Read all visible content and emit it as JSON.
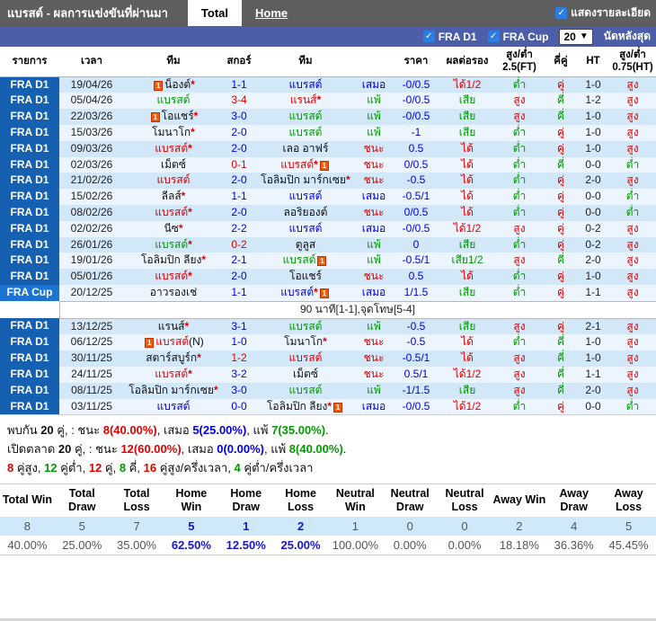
{
  "header": {
    "title": "แบรสต์ - ผลการแข่งขันที่ผ่านมา",
    "tabs": [
      {
        "label": "Total",
        "active": true
      },
      {
        "label": "Home",
        "active": false
      }
    ],
    "show_details_label": "แสดงรายละเอียด"
  },
  "filter_bar": {
    "leagues": [
      "FRA D1",
      "FRA Cup"
    ],
    "match_count": "20",
    "last_matches_label": "นัดหลังสุด"
  },
  "colors": {
    "topbar_bg": "#5e5e5e",
    "filterbar_bg": "#4c5ea8",
    "checkbox_blue": "#2b7de0",
    "fra_d1_bg": "#1560b0",
    "fra_cup_bg": "#1a74d4",
    "row_odd_bg": "#d2e7f7",
    "row_even_bg": "#ecf5fd",
    "win_red": "#e00000",
    "draw_blue": "#0000e0",
    "loss_green": "#009900",
    "text_black": "#111111",
    "stats_count_bg": "#cfe9fb",
    "home_stat_blue": "#1515cc",
    "muted_gray": "#555555",
    "card_icon_orange": "#f25c05"
  },
  "table": {
    "headers": [
      "รายการ",
      "เวลา",
      "ทีม",
      "สกอร์",
      "ทีม",
      "",
      "ราคา",
      "ผลต่อรอง",
      "สูง/ต่ำ 2.5(FT)",
      "คี่คู่",
      "HT",
      "สูง/ต่ำ 0.75(HT)"
    ]
  },
  "matches": [
    {
      "league": "FRA D1",
      "date": "19/04/26",
      "home": {
        "name": "น็องต์",
        "color": "black",
        "star": true,
        "icon": "before"
      },
      "score": {
        "t": "1-1",
        "c": "blue"
      },
      "away": {
        "name": "แบรสต์",
        "color": "blue",
        "star": false,
        "icon": null
      },
      "result": {
        "t": "เสมอ",
        "c": "blue"
      },
      "handicap": "-0/0.5",
      "hdp_result": {
        "t": "ได้1/2",
        "c": "red"
      },
      "ou25": {
        "t": "ต่ำ",
        "c": "green"
      },
      "odd_even": {
        "t": "คู่",
        "c": "red"
      },
      "ht": "1-0",
      "ou075": {
        "t": "สูง",
        "c": "red"
      }
    },
    {
      "league": "FRA D1",
      "date": "05/04/26",
      "home": {
        "name": "แบรสต์",
        "color": "green",
        "star": false,
        "icon": null
      },
      "score": {
        "t": "3-4",
        "c": "red"
      },
      "away": {
        "name": "แรนส์",
        "color": "red",
        "star": true,
        "icon": null
      },
      "result": {
        "t": "แพ้",
        "c": "green"
      },
      "handicap": "-0/0.5",
      "hdp_result": {
        "t": "เสีย",
        "c": "green"
      },
      "ou25": {
        "t": "สูง",
        "c": "red"
      },
      "odd_even": {
        "t": "คี่",
        "c": "green"
      },
      "ht": "1-2",
      "ou075": {
        "t": "สูง",
        "c": "red"
      }
    },
    {
      "league": "FRA D1",
      "date": "22/03/26",
      "home": {
        "name": "โอแชร์",
        "color": "black",
        "star": true,
        "icon": "before"
      },
      "score": {
        "t": "3-0",
        "c": "blue"
      },
      "away": {
        "name": "แบรสต์",
        "color": "green",
        "star": false,
        "icon": null
      },
      "result": {
        "t": "แพ้",
        "c": "green"
      },
      "handicap": "-0/0.5",
      "hdp_result": {
        "t": "เสีย",
        "c": "green"
      },
      "ou25": {
        "t": "สูง",
        "c": "red"
      },
      "odd_even": {
        "t": "คี่",
        "c": "green"
      },
      "ht": "1-0",
      "ou075": {
        "t": "สูง",
        "c": "red"
      }
    },
    {
      "league": "FRA D1",
      "date": "15/03/26",
      "home": {
        "name": "โมนาโก",
        "color": "black",
        "star": true,
        "icon": null
      },
      "score": {
        "t": "2-0",
        "c": "blue"
      },
      "away": {
        "name": "แบรสต์",
        "color": "green",
        "star": false,
        "icon": null
      },
      "result": {
        "t": "แพ้",
        "c": "green"
      },
      "handicap": "-1",
      "hdp_result": {
        "t": "เสีย",
        "c": "green"
      },
      "ou25": {
        "t": "ต่ำ",
        "c": "green"
      },
      "odd_even": {
        "t": "คู่",
        "c": "red"
      },
      "ht": "1-0",
      "ou075": {
        "t": "สูง",
        "c": "red"
      }
    },
    {
      "league": "FRA D1",
      "date": "09/03/26",
      "home": {
        "name": "แบรสต์",
        "color": "red",
        "star": true,
        "icon": null
      },
      "score": {
        "t": "2-0",
        "c": "blue"
      },
      "away": {
        "name": "เลอ อาฟร์",
        "color": "black",
        "star": false,
        "icon": null
      },
      "result": {
        "t": "ชนะ",
        "c": "red"
      },
      "handicap": "0.5",
      "hdp_result": {
        "t": "ได้",
        "c": "red"
      },
      "ou25": {
        "t": "ต่ำ",
        "c": "green"
      },
      "odd_even": {
        "t": "คู่",
        "c": "red"
      },
      "ht": "1-0",
      "ou075": {
        "t": "สูง",
        "c": "red"
      }
    },
    {
      "league": "FRA D1",
      "date": "02/03/26",
      "home": {
        "name": "เม็ตซ์",
        "color": "black",
        "star": false,
        "icon": null
      },
      "score": {
        "t": "0-1",
        "c": "red"
      },
      "away": {
        "name": "แบรสต์",
        "color": "red",
        "star": true,
        "icon": "after"
      },
      "result": {
        "t": "ชนะ",
        "c": "red"
      },
      "handicap": "0/0.5",
      "hdp_result": {
        "t": "ได้",
        "c": "red"
      },
      "ou25": {
        "t": "ต่ำ",
        "c": "green"
      },
      "odd_even": {
        "t": "คี่",
        "c": "green"
      },
      "ht": "0-0",
      "ou075": {
        "t": "ต่ำ",
        "c": "green"
      }
    },
    {
      "league": "FRA D1",
      "date": "21/02/26",
      "home": {
        "name": "แบรสต์",
        "color": "red",
        "star": false,
        "icon": null
      },
      "score": {
        "t": "2-0",
        "c": "blue"
      },
      "away": {
        "name": "โอลิมปิก มาร์กเซย",
        "color": "black",
        "star": true,
        "icon": null
      },
      "result": {
        "t": "ชนะ",
        "c": "red"
      },
      "handicap": "-0.5",
      "hdp_result": {
        "t": "ได้",
        "c": "red"
      },
      "ou25": {
        "t": "ต่ำ",
        "c": "green"
      },
      "odd_even": {
        "t": "คู่",
        "c": "red"
      },
      "ht": "2-0",
      "ou075": {
        "t": "สูง",
        "c": "red"
      }
    },
    {
      "league": "FRA D1",
      "date": "15/02/26",
      "home": {
        "name": "ลีลส์",
        "color": "black",
        "star": true,
        "icon": null
      },
      "score": {
        "t": "1-1",
        "c": "blue"
      },
      "away": {
        "name": "แบรสต์",
        "color": "blue",
        "star": false,
        "icon": null
      },
      "result": {
        "t": "เสมอ",
        "c": "blue"
      },
      "handicap": "-0.5/1",
      "hdp_result": {
        "t": "ได้",
        "c": "red"
      },
      "ou25": {
        "t": "ต่ำ",
        "c": "green"
      },
      "odd_even": {
        "t": "คู่",
        "c": "red"
      },
      "ht": "0-0",
      "ou075": {
        "t": "ต่ำ",
        "c": "green"
      }
    },
    {
      "league": "FRA D1",
      "date": "08/02/26",
      "home": {
        "name": "แบรสต์",
        "color": "red",
        "star": true,
        "icon": null
      },
      "score": {
        "t": "2-0",
        "c": "blue"
      },
      "away": {
        "name": "ลอริยองต์",
        "color": "black",
        "star": false,
        "icon": null
      },
      "result": {
        "t": "ชนะ",
        "c": "red"
      },
      "handicap": "0/0.5",
      "hdp_result": {
        "t": "ได้",
        "c": "red"
      },
      "ou25": {
        "t": "ต่ำ",
        "c": "green"
      },
      "odd_even": {
        "t": "คู่",
        "c": "red"
      },
      "ht": "0-0",
      "ou075": {
        "t": "ต่ำ",
        "c": "green"
      }
    },
    {
      "league": "FRA D1",
      "date": "02/02/26",
      "home": {
        "name": "นีซ",
        "color": "black",
        "star": true,
        "icon": null
      },
      "score": {
        "t": "2-2",
        "c": "blue"
      },
      "away": {
        "name": "แบรสต์",
        "color": "blue",
        "star": false,
        "icon": null
      },
      "result": {
        "t": "เสมอ",
        "c": "blue"
      },
      "handicap": "-0/0.5",
      "hdp_result": {
        "t": "ได้1/2",
        "c": "red"
      },
      "ou25": {
        "t": "สูง",
        "c": "red"
      },
      "odd_even": {
        "t": "คู่",
        "c": "red"
      },
      "ht": "0-2",
      "ou075": {
        "t": "สูง",
        "c": "red"
      }
    },
    {
      "league": "FRA D1",
      "date": "26/01/26",
      "home": {
        "name": "แบรสต์",
        "color": "green",
        "star": true,
        "icon": null
      },
      "score": {
        "t": "0-2",
        "c": "red"
      },
      "away": {
        "name": "ตูลูส",
        "color": "black",
        "star": false,
        "icon": null
      },
      "result": {
        "t": "แพ้",
        "c": "green"
      },
      "handicap": "0",
      "hdp_result": {
        "t": "เสีย",
        "c": "green"
      },
      "ou25": {
        "t": "ต่ำ",
        "c": "green"
      },
      "odd_even": {
        "t": "คู่",
        "c": "red"
      },
      "ht": "0-2",
      "ou075": {
        "t": "สูง",
        "c": "red"
      }
    },
    {
      "league": "FRA D1",
      "date": "19/01/26",
      "home": {
        "name": "โอลิมปิก ลียง",
        "color": "black",
        "star": true,
        "icon": null
      },
      "score": {
        "t": "2-1",
        "c": "blue"
      },
      "away": {
        "name": "แบรสต์",
        "color": "green",
        "star": false,
        "icon": "after"
      },
      "result": {
        "t": "แพ้",
        "c": "green"
      },
      "handicap": "-0.5/1",
      "hdp_result": {
        "t": "เสีย1/2",
        "c": "green"
      },
      "ou25": {
        "t": "สูง",
        "c": "red"
      },
      "odd_even": {
        "t": "คี่",
        "c": "green"
      },
      "ht": "2-0",
      "ou075": {
        "t": "สูง",
        "c": "red"
      }
    },
    {
      "league": "FRA D1",
      "date": "05/01/26",
      "home": {
        "name": "แบรสต์",
        "color": "red",
        "star": true,
        "icon": null
      },
      "score": {
        "t": "2-0",
        "c": "blue"
      },
      "away": {
        "name": "โอแชร์",
        "color": "black",
        "star": false,
        "icon": null
      },
      "result": {
        "t": "ชนะ",
        "c": "red"
      },
      "handicap": "0.5",
      "hdp_result": {
        "t": "ได้",
        "c": "red"
      },
      "ou25": {
        "t": "ต่ำ",
        "c": "green"
      },
      "odd_even": {
        "t": "คู่",
        "c": "red"
      },
      "ht": "1-0",
      "ou075": {
        "t": "สูง",
        "c": "red"
      }
    },
    {
      "league": "FRA Cup",
      "date": "20/12/25",
      "home": {
        "name": "อาวรองเช่",
        "color": "black",
        "star": false,
        "icon": null
      },
      "score": {
        "t": "1-1",
        "c": "blue"
      },
      "away": {
        "name": "แบรสต์",
        "color": "blue",
        "star": true,
        "icon": "after"
      },
      "result": {
        "t": "เสมอ",
        "c": "blue"
      },
      "handicap": "1/1.5",
      "hdp_result": {
        "t": "เสีย",
        "c": "green"
      },
      "ou25": {
        "t": "ต่ำ",
        "c": "green"
      },
      "odd_even": {
        "t": "คู่",
        "c": "red"
      },
      "ht": "1-1",
      "ou075": {
        "t": "สูง",
        "c": "red"
      }
    },
    {
      "note": "90 นาที[1-1],จุดโทษ[5-4]"
    },
    {
      "league": "FRA D1",
      "date": "13/12/25",
      "home": {
        "name": "แรนส์",
        "color": "black",
        "star": true,
        "icon": null
      },
      "score": {
        "t": "3-1",
        "c": "blue"
      },
      "away": {
        "name": "แบรสต์",
        "color": "green",
        "star": false,
        "icon": null
      },
      "result": {
        "t": "แพ้",
        "c": "green"
      },
      "handicap": "-0.5",
      "hdp_result": {
        "t": "เสีย",
        "c": "green"
      },
      "ou25": {
        "t": "สูง",
        "c": "red"
      },
      "odd_even": {
        "t": "คู่",
        "c": "red"
      },
      "ht": "2-1",
      "ou075": {
        "t": "สูง",
        "c": "red"
      }
    },
    {
      "league": "FRA D1",
      "date": "06/12/25",
      "home": {
        "name": "แบรสต์",
        "color": "red",
        "star": false,
        "icon": "before",
        "suffix": "(N)"
      },
      "score": {
        "t": "1-0",
        "c": "blue"
      },
      "away": {
        "name": "โมนาโก",
        "color": "black",
        "star": true,
        "icon": null
      },
      "result": {
        "t": "ชนะ",
        "c": "red"
      },
      "handicap": "-0.5",
      "hdp_result": {
        "t": "ได้",
        "c": "red"
      },
      "ou25": {
        "t": "ต่ำ",
        "c": "green"
      },
      "odd_even": {
        "t": "คี่",
        "c": "green"
      },
      "ht": "1-0",
      "ou075": {
        "t": "สูง",
        "c": "red"
      }
    },
    {
      "league": "FRA D1",
      "date": "30/11/25",
      "home": {
        "name": "สตาร์สบูร์ก",
        "color": "black",
        "star": true,
        "icon": null
      },
      "score": {
        "t": "1-2",
        "c": "red"
      },
      "away": {
        "name": "แบรสต์",
        "color": "red",
        "star": false,
        "icon": null
      },
      "result": {
        "t": "ชนะ",
        "c": "red"
      },
      "handicap": "-0.5/1",
      "hdp_result": {
        "t": "ได้",
        "c": "red"
      },
      "ou25": {
        "t": "สูง",
        "c": "red"
      },
      "odd_even": {
        "t": "คี่",
        "c": "green"
      },
      "ht": "1-0",
      "ou075": {
        "t": "สูง",
        "c": "red"
      }
    },
    {
      "league": "FRA D1",
      "date": "24/11/25",
      "home": {
        "name": "แบรสต์",
        "color": "red",
        "star": true,
        "icon": null
      },
      "score": {
        "t": "3-2",
        "c": "blue"
      },
      "away": {
        "name": "เม็ตซ์",
        "color": "black",
        "star": false,
        "icon": null
      },
      "result": {
        "t": "ชนะ",
        "c": "red"
      },
      "handicap": "0.5/1",
      "hdp_result": {
        "t": "ได้1/2",
        "c": "red"
      },
      "ou25": {
        "t": "สูง",
        "c": "red"
      },
      "odd_even": {
        "t": "คี่",
        "c": "green"
      },
      "ht": "1-1",
      "ou075": {
        "t": "สูง",
        "c": "red"
      }
    },
    {
      "league": "FRA D1",
      "date": "08/11/25",
      "home": {
        "name": "โอลิมปิก มาร์กเซย",
        "color": "black",
        "star": true,
        "icon": null
      },
      "score": {
        "t": "3-0",
        "c": "blue"
      },
      "away": {
        "name": "แบรสต์",
        "color": "green",
        "star": false,
        "icon": null
      },
      "result": {
        "t": "แพ้",
        "c": "green"
      },
      "handicap": "-1/1.5",
      "hdp_result": {
        "t": "เสีย",
        "c": "green"
      },
      "ou25": {
        "t": "สูง",
        "c": "red"
      },
      "odd_even": {
        "t": "คี่",
        "c": "green"
      },
      "ht": "2-0",
      "ou075": {
        "t": "สูง",
        "c": "red"
      }
    },
    {
      "league": "FRA D1",
      "date": "03/11/25",
      "home": {
        "name": "แบรสต์",
        "color": "blue",
        "star": false,
        "icon": null
      },
      "score": {
        "t": "0-0",
        "c": "blue"
      },
      "away": {
        "name": "โอลิมปิก ลียง",
        "color": "black",
        "star": true,
        "icon": "after"
      },
      "result": {
        "t": "เสมอ",
        "c": "blue"
      },
      "handicap": "-0/0.5",
      "hdp_result": {
        "t": "ได้1/2",
        "c": "red"
      },
      "ou25": {
        "t": "ต่ำ",
        "c": "green"
      },
      "odd_even": {
        "t": "คู่",
        "c": "red"
      },
      "ht": "0-0",
      "ou075": {
        "t": "ต่ำ",
        "c": "green"
      }
    }
  ],
  "summary": {
    "lines": [
      [
        {
          "t": "พบกัน "
        },
        {
          "t": "20",
          "b": true
        },
        {
          "t": " คู่, : ชนะ "
        },
        {
          "t": "8(40.00%)",
          "c": "red",
          "b": true
        },
        {
          "t": ", เสมอ "
        },
        {
          "t": "5(25.00%)",
          "c": "blue",
          "b": true
        },
        {
          "t": ", แพ้ "
        },
        {
          "t": "7(35.00%)",
          "c": "green",
          "b": true
        },
        {
          "t": "."
        }
      ],
      [
        {
          "t": "เปิดตลาด "
        },
        {
          "t": "20",
          "b": true
        },
        {
          "t": " คู่, : ชนะ "
        },
        {
          "t": "12(60.00%)",
          "c": "red",
          "b": true
        },
        {
          "t": ", เสมอ "
        },
        {
          "t": "0(0.00%)",
          "c": "blue",
          "b": true
        },
        {
          "t": ", แพ้ "
        },
        {
          "t": "8(40.00%)",
          "c": "green",
          "b": true
        },
        {
          "t": "."
        }
      ],
      [
        {
          "t": "8",
          "c": "red",
          "b": true
        },
        {
          "t": " คู่สูง, "
        },
        {
          "t": "12",
          "c": "green",
          "b": true
        },
        {
          "t": " คู่ต่ำ, "
        },
        {
          "t": "12",
          "c": "red",
          "b": true
        },
        {
          "t": " คู่, "
        },
        {
          "t": "8",
          "c": "green",
          "b": true
        },
        {
          "t": " คี่, "
        },
        {
          "t": "16",
          "c": "red",
          "b": true
        },
        {
          "t": " คู่สูง/ครึ่งเวลา, "
        },
        {
          "t": "4",
          "c": "green",
          "b": true
        },
        {
          "t": " คู่ต่ำ/ครึ่งเวลา"
        }
      ]
    ]
  },
  "stats_table": {
    "columns": [
      {
        "label": "Total Win",
        "count": "8",
        "pct": "40.00%",
        "group": "total"
      },
      {
        "label": "Total Draw",
        "count": "5",
        "pct": "25.00%",
        "group": "total"
      },
      {
        "label": "Total Loss",
        "count": "7",
        "pct": "35.00%",
        "group": "total"
      },
      {
        "label": "Home Win",
        "count": "5",
        "pct": "62.50%",
        "group": "home"
      },
      {
        "label": "Home Draw",
        "count": "1",
        "pct": "12.50%",
        "group": "home"
      },
      {
        "label": "Home Loss",
        "count": "2",
        "pct": "25.00%",
        "group": "home"
      },
      {
        "label": "Neutral Win",
        "count": "1",
        "pct": "100.00%",
        "group": "neutral"
      },
      {
        "label": "Neutral Draw",
        "count": "0",
        "pct": "0.00%",
        "group": "neutral"
      },
      {
        "label": "Neutral Loss",
        "count": "0",
        "pct": "0.00%",
        "group": "neutral"
      },
      {
        "label": "Away Win",
        "count": "2",
        "pct": "18.18%",
        "group": "away"
      },
      {
        "label": "Away Draw",
        "count": "4",
        "pct": "36.36%",
        "group": "away"
      },
      {
        "label": "Away Loss",
        "count": "5",
        "pct": "45.45%",
        "group": "away"
      }
    ]
  }
}
